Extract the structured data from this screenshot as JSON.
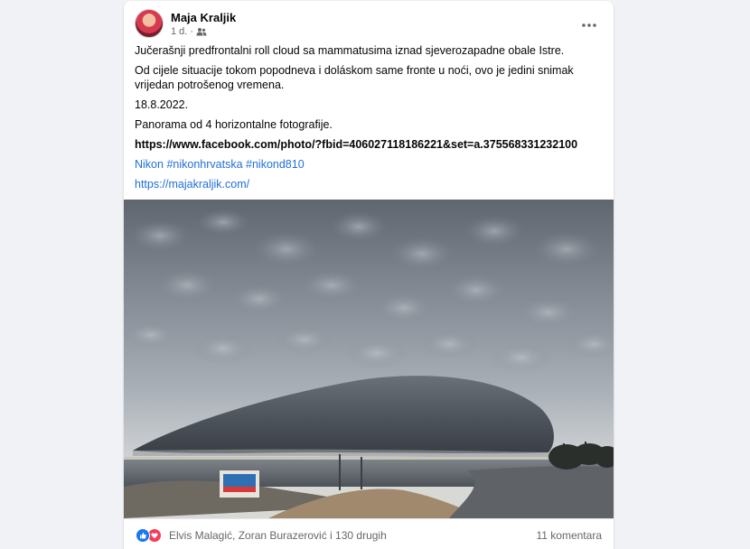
{
  "post": {
    "author": "Maja Kraljik",
    "time": "1 d.",
    "audience_icon": "friends-icon",
    "more_icon": "more-options-icon",
    "paragraphs": [
      "Jučerašnji predfrontalni roll cloud sa mammatusima iznad sjeverozapadne obale Istre.",
      "Od cijele situacije tokom popodneva i doláskom same fronte u noći, ovo je jedini snimak vrijedan potrošenog vremena.",
      "18.8.2022.",
      "Panorama od 4 horizontalne fotografije."
    ],
    "link_bold": "https://www.facebook.com/photo/?fbid=406027118186221&set=a.375568331232100",
    "hashtags": [
      "Nikon",
      "#nikonhrvatska",
      "#nikond810"
    ],
    "website": "https://majakraljik.com/"
  },
  "footer": {
    "reaction_icons": [
      "like-icon",
      "love-icon"
    ],
    "reactors": "Elvis Malagić, Zoran Burazerović i 130 drugih",
    "comments": "11 komentara"
  },
  "colors": {
    "link_blue": "#216fdb",
    "like_blue": "#1877f2",
    "love_red": "#f33e58",
    "muted": "#65676b"
  }
}
